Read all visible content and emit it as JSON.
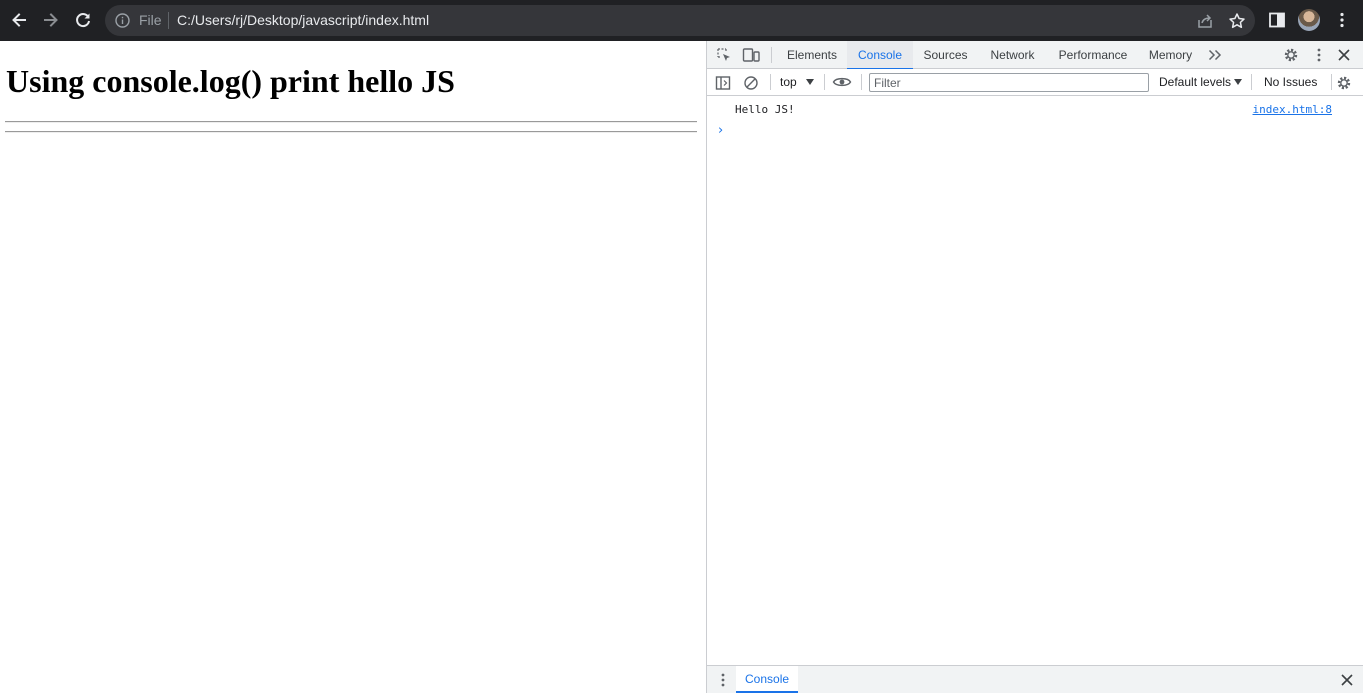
{
  "browser": {
    "omnibox": {
      "scheme_label": "File",
      "url": "C:/Users/rj/Desktop/javascript/index.html"
    },
    "icons": [
      "back-arrow-icon",
      "forward-arrow-icon",
      "reload-icon",
      "info-icon",
      "share-icon",
      "bookmark-star-icon",
      "side-panel-icon",
      "profile-avatar",
      "menu-dots-icon"
    ]
  },
  "page": {
    "heading": "Using console.log() print hello JS"
  },
  "devtools": {
    "tabs": [
      {
        "label": "Elements"
      },
      {
        "label": "Console"
      },
      {
        "label": "Sources"
      },
      {
        "label": "Network"
      },
      {
        "label": "Performance"
      },
      {
        "label": "Memory"
      }
    ],
    "active_tab": "Console",
    "toolbar": {
      "context": "top",
      "filter_placeholder": "Filter",
      "levels": "Default levels",
      "issues": "No Issues"
    },
    "console": {
      "messages": [
        {
          "text": "Hello JS!",
          "source": "index.html:8"
        }
      ],
      "prompt": "›"
    },
    "drawer": {
      "tab_label": "Console"
    }
  },
  "colors": {
    "accent": "#1a73e8",
    "browser_frame": "#202124",
    "omnibox": "#35363a"
  }
}
